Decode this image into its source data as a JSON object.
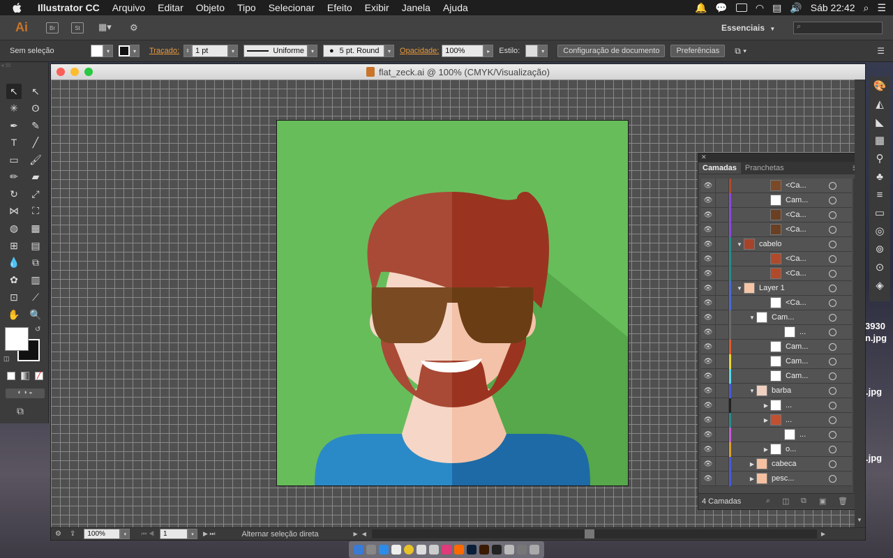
{
  "menubar": {
    "app_name": "Illustrator CC",
    "items": [
      "Arquivo",
      "Editar",
      "Objeto",
      "Tipo",
      "Selecionar",
      "Efeito",
      "Exibir",
      "Janela",
      "Ajuda"
    ],
    "clock": "Sáb 22:42"
  },
  "appbar": {
    "logo": "Ai",
    "bridge": "Br",
    "stock": "St",
    "workspace": "Essenciais"
  },
  "control": {
    "selection_status": "Sem seleção",
    "stroke_label": "Traçado:",
    "stroke_weight": "1 pt",
    "stroke_profile": "Uniforme",
    "brush": "5 pt. Round",
    "opacity_label": "Opacidade:",
    "opacity": "100%",
    "style_label": "Estilo:",
    "doc_setup": "Configuração de documento",
    "prefs": "Preferências"
  },
  "document": {
    "title": "flat_zeck.ai @ 100% (CMYK/Visualização)",
    "zoom": "100%",
    "artboard": "1",
    "status": "Alternar seleção direta"
  },
  "layers_panel": {
    "tab_layers": "Camadas",
    "tab_artboards": "Pranchetas",
    "footer": "4 Camadas",
    "rows": [
      {
        "name": "<Ca...",
        "color": "#b04a2a",
        "thumb": "#7a4a28",
        "indent": 0,
        "tri": ""
      },
      {
        "name": "Cam...",
        "color": "#8a4ad8",
        "thumb": "#ffffff",
        "indent": 0,
        "tri": ""
      },
      {
        "name": "<Ca...",
        "color": "#8a4ad8",
        "thumb": "#6a3f22",
        "indent": 0,
        "tri": ""
      },
      {
        "name": "<Ca...",
        "color": "#8a4ad8",
        "thumb": "#6a3f22",
        "indent": 0,
        "tri": ""
      },
      {
        "name": "cabelo",
        "color": "#2a8a8a",
        "thumb": "#a8432b",
        "indent": -40,
        "tri": "▼"
      },
      {
        "name": "<Ca...",
        "color": "#2a8a8a",
        "thumb": "#b04a2a",
        "indent": 0,
        "tri": ""
      },
      {
        "name": "<Ca...",
        "color": "#2a8a8a",
        "thumb": "#b04a2a",
        "indent": 0,
        "tri": ""
      },
      {
        "name": "Layer 1",
        "color": "#4a6ad8",
        "thumb": "#f5c5a5",
        "indent": -40,
        "tri": "▼"
      },
      {
        "name": "<Ca...",
        "color": "#4a6ad8",
        "thumb": "#ffffff",
        "indent": 0,
        "tri": ""
      },
      {
        "name": "Cam...",
        "color": "#6a6a6a",
        "thumb": "#ffffff",
        "indent": -20,
        "tri": "▼"
      },
      {
        "name": "...",
        "color": "#6a6a6a",
        "thumb": "#ffffff",
        "indent": 20,
        "tri": ""
      },
      {
        "name": "Cam...",
        "color": "#e05a2a",
        "thumb": "#ffffff",
        "indent": 0,
        "tri": ""
      },
      {
        "name": "Cam...",
        "color": "#e8d830",
        "thumb": "#ffffff",
        "indent": 0,
        "tri": ""
      },
      {
        "name": "Cam...",
        "color": "#5ad8e8",
        "thumb": "#ffffff",
        "indent": 0,
        "tri": ""
      },
      {
        "name": "barba",
        "color": "#4a5ad8",
        "thumb": "#f0d0c0",
        "indent": -20,
        "tri": "▼"
      },
      {
        "name": "...",
        "color": "#222222",
        "thumb": "#ffffff",
        "indent": 0,
        "tri": "▶"
      },
      {
        "name": "...",
        "color": "#2a8a8a",
        "thumb": "#c05030",
        "indent": 0,
        "tri": "▶"
      },
      {
        "name": "...",
        "color": "#c85ad8",
        "thumb": "#ffffff",
        "indent": 20,
        "tri": ""
      },
      {
        "name": "o...",
        "color": "#d8a030",
        "thumb": "#ffffff",
        "indent": 0,
        "tri": "▶"
      },
      {
        "name": "cabeca",
        "color": "#4a5ad8",
        "thumb": "#f5c0a0",
        "indent": -20,
        "tri": "▶"
      },
      {
        "name": "pesc...",
        "color": "#4a5ad8",
        "thumb": "#f5c0a0",
        "indent": -20,
        "tri": "▶"
      }
    ]
  },
  "desktop_labels": [
    "3930",
    "n.jpg",
    ".jpg",
    ".jpg"
  ],
  "colors": {
    "bg_green": "#68bd5b",
    "shadow_green": "#56a84a",
    "hair_light": "#a84a36",
    "hair_dark": "#9a3420",
    "skin_light": "#f6d6c6",
    "skin_dark": "#f3c2a8",
    "glasses_light": "#7a4a22",
    "glasses_dark": "#6a3d14",
    "shirt_light": "#2a8ac8",
    "shirt_dark": "#1e6aa6"
  }
}
